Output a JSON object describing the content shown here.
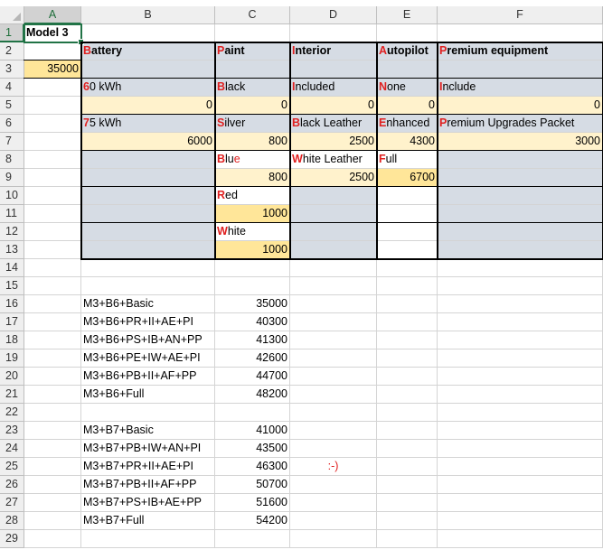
{
  "columns": [
    "A",
    "B",
    "C",
    "D",
    "E",
    "F"
  ],
  "rows": [
    1,
    2,
    3,
    4,
    5,
    6,
    7,
    8,
    9,
    10,
    11,
    12,
    13,
    14,
    15,
    16,
    17,
    18,
    19,
    20,
    21,
    22,
    23,
    24,
    25,
    26,
    27,
    28,
    29
  ],
  "cells": {
    "A1": "Model 3",
    "A3": "35000",
    "B2": "Battery",
    "C2": "Paint",
    "D2": "Interior",
    "E2": "Autopilot",
    "F2": "Premium equipment",
    "B4": "60 kWh",
    "C4": "Black",
    "D4": "Included",
    "E4": "None",
    "F4": "Include",
    "B5": "0",
    "C5": "0",
    "D5": "0",
    "E5": "0",
    "F5": "0",
    "B6": "75 kWh",
    "C6": "Silver",
    "D6": "Black Leather",
    "E6": "Enhanced",
    "F6": "Premium Upgrades Packet",
    "B7": "6000",
    "C7": "800",
    "D7": "2500",
    "E7": "4300",
    "F7": "3000",
    "C8": "Blue",
    "D8": "White Leather",
    "E8": "Full",
    "C9": "800",
    "D9": "2500",
    "E9": "6700",
    "C10": "Red",
    "C11": "1000",
    "C12": "White",
    "C13": "1000",
    "B16": "M3+B6+Basic",
    "C16": "35000",
    "B17": "M3+B6+PR+II+AE+PI",
    "C17": "40300",
    "B18": "M3+B6+PS+IB+AN+PP",
    "C18": "41300",
    "B19": "M3+B6+PE+IW+AE+PI",
    "C19": "42600",
    "B20": "M3+B6+PB+II+AF+PP",
    "C20": "44700",
    "B21": "M3+B6+Full",
    "C21": "48200",
    "B23": "M3+B7+Basic",
    "C23": "41000",
    "B24": "M3+B7+PB+IW+AN+PI",
    "C24": "43500",
    "B25": "M3+B7+PR+II+AE+PI",
    "C25": "46300",
    "D25": ":-)",
    "B26": "M3+B7+PB+II+AF+PP",
    "C26": "50700",
    "B27": "M3+B7+PS+IB+AE+PP",
    "C27": "51600",
    "B28": "M3+B7+Full",
    "C28": "54200"
  },
  "colors": {
    "table_gray": "#d6dce4",
    "value_yellow": "#fff2cc",
    "base_orange": "#ffe699",
    "accent_red": "#e02020",
    "selection_green": "#217346"
  },
  "selected_cell": "A1"
}
